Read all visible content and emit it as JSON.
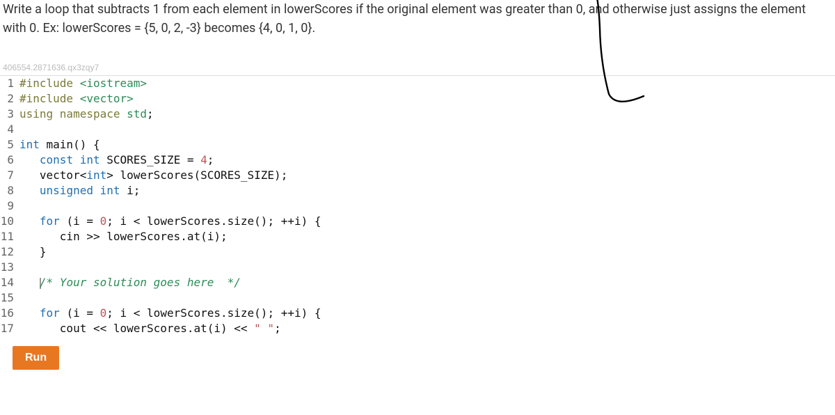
{
  "instructions": "Write a loop that subtracts 1 from each element in lowerScores if the original element was greater than 0, and otherwise just assigns the element with 0. Ex: lowerScores = {5, 0, 2, -3} becomes {4, 0, 1, 0}.",
  "watermark": "406554.2871636.qx3zqy7",
  "run_label": "Run",
  "code": {
    "l1": {
      "n": "1",
      "a": "#include ",
      "b": "<iostream>"
    },
    "l2": {
      "n": "2",
      "a": "#include ",
      "b": "<vector>"
    },
    "l3": {
      "n": "3",
      "a": "using ",
      "b": "namespace ",
      "c": "std",
      "d": ";"
    },
    "l4": {
      "n": "4",
      "a": ""
    },
    "l5": {
      "n": "5",
      "a": "int ",
      "b": "main",
      "c": "() {"
    },
    "l6": {
      "n": "6",
      "a": "   ",
      "b": "const int ",
      "c": "SCORES_SIZE = ",
      "d": "4",
      "e": ";"
    },
    "l7": {
      "n": "7",
      "a": "   vector<",
      "b": "int",
      "c": "> lowerScores(SCORES_SIZE);"
    },
    "l8": {
      "n": "8",
      "a": "   ",
      "b": "unsigned int ",
      "c": "i;"
    },
    "l9": {
      "n": "9",
      "a": ""
    },
    "l10": {
      "n": "10",
      "a": "   ",
      "b": "for ",
      "c": "(i = ",
      "d": "0",
      "e": "; i < lowerScores.size(); ++i) {"
    },
    "l11": {
      "n": "11",
      "a": "      cin >> lowerScores.at(i);"
    },
    "l12": {
      "n": "12",
      "a": "   }"
    },
    "l13": {
      "n": "13",
      "a": ""
    },
    "l14": {
      "n": "14",
      "a": "   ",
      "b": "/* Your solution goes here  */"
    },
    "l15": {
      "n": "15",
      "a": ""
    },
    "l16": {
      "n": "16",
      "a": "   ",
      "b": "for ",
      "c": "(i = ",
      "d": "0",
      "e": "; i < lowerScores.size(); ++i) {"
    },
    "l17": {
      "n": "17",
      "a": "      cout << lowerScores.at(i) << ",
      "b": "\" \"",
      "c": ";"
    }
  }
}
